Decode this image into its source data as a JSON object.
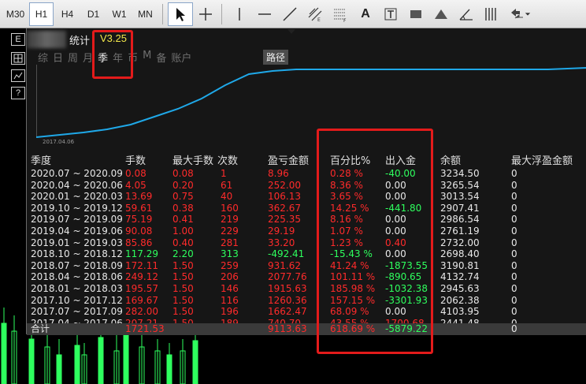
{
  "toolbar": {
    "timeframes": [
      {
        "label": "M30",
        "active": false
      },
      {
        "label": "H1",
        "active": true
      },
      {
        "label": "H4",
        "active": false
      },
      {
        "label": "D1",
        "active": false
      },
      {
        "label": "W1",
        "active": false
      },
      {
        "label": "MN",
        "active": false
      }
    ],
    "text_tool_label": "A"
  },
  "left_buttons": [
    "E",
    "",
    "",
    "?"
  ],
  "panel": {
    "title": "统计",
    "version": "V3.25",
    "tabs": [
      {
        "label": "综",
        "active": false
      },
      {
        "label": "日",
        "active": false
      },
      {
        "label": "周",
        "active": false
      },
      {
        "label": "月",
        "active": false
      },
      {
        "label": "季",
        "active": true
      },
      {
        "label": "年",
        "active": false
      },
      {
        "label": "币",
        "active": false
      },
      {
        "label": "M",
        "active": false
      },
      {
        "label": "备",
        "active": false
      },
      {
        "label": "账户",
        "active": false
      }
    ],
    "route_label": "路径",
    "curve_start_label": "2017.04.06",
    "headers": [
      "季度",
      "手数",
      "最大手数",
      "次数",
      "盈亏金额",
      "百分比%",
      "出入金",
      "余额",
      "最大浮盈金额"
    ],
    "rows": [
      {
        "period": "2020.07 ~ 2020.09",
        "lots": "0.08",
        "max_lots": "0.08",
        "count": "1",
        "pnl": "8.96",
        "pct": "0.28 %",
        "flow": "-40.00",
        "flow_color": "green",
        "balance": "3234.50",
        "max_float": "0"
      },
      {
        "period": "2020.04 ~ 2020.06",
        "lots": "4.05",
        "max_lots": "0.20",
        "count": "61",
        "pnl": "252.00",
        "pct": "8.36 %",
        "flow": "0.00",
        "flow_color": "white",
        "balance": "3265.54",
        "max_float": "0"
      },
      {
        "period": "2020.01 ~ 2020.03",
        "lots": "13.69",
        "max_lots": "0.75",
        "count": "40",
        "pnl": "106.13",
        "pct": "3.65 %",
        "flow": "0.00",
        "flow_color": "white",
        "balance": "3013.54",
        "max_float": "0"
      },
      {
        "period": "2019.10 ~ 2019.12",
        "lots": "59.61",
        "max_lots": "0.38",
        "count": "160",
        "pnl": "362.67",
        "pct": "14.25 %",
        "flow": "-441.80",
        "flow_color": "green",
        "balance": "2907.41",
        "max_float": "0"
      },
      {
        "period": "2019.07 ~ 2019.09",
        "lots": "75.19",
        "max_lots": "0.41",
        "count": "219",
        "pnl": "225.35",
        "pct": "8.16 %",
        "flow": "0.00",
        "flow_color": "white",
        "balance": "2986.54",
        "max_float": "0"
      },
      {
        "period": "2019.04 ~ 2019.06",
        "lots": "90.08",
        "max_lots": "1.00",
        "count": "229",
        "pnl": "29.19",
        "pct": "1.07 %",
        "flow": "0.00",
        "flow_color": "white",
        "balance": "2761.19",
        "max_float": "0"
      },
      {
        "period": "2019.01 ~ 2019.03",
        "lots": "85.86",
        "max_lots": "0.40",
        "count": "281",
        "pnl": "33.20",
        "pct": "1.23 %",
        "flow": "0.40",
        "flow_color": "red",
        "balance": "2732.00",
        "max_float": "0"
      },
      {
        "period": "2018.10 ~ 2018.12",
        "lots": "117.29",
        "max_lots": "2.20",
        "count": "313",
        "pnl": "-492.41",
        "pct": "-15.43 %",
        "flow": "0.00",
        "flow_color": "white",
        "balance": "2698.40",
        "max_float": "0",
        "neg": true
      },
      {
        "period": "2018.07 ~ 2018.09",
        "lots": "172.11",
        "max_lots": "1.50",
        "count": "259",
        "pnl": "931.62",
        "pct": "41.24 %",
        "flow": "-1873.55",
        "flow_color": "green",
        "balance": "3190.81",
        "max_float": "0"
      },
      {
        "period": "2018.04 ~ 2018.06",
        "lots": "249.12",
        "max_lots": "1.50",
        "count": "206",
        "pnl": "2077.76",
        "pct": "101.11 %",
        "flow": "-890.65",
        "flow_color": "green",
        "balance": "4132.74",
        "max_float": "0"
      },
      {
        "period": "2018.01 ~ 2018.03",
        "lots": "195.57",
        "max_lots": "1.50",
        "count": "146",
        "pnl": "1915.63",
        "pct": "185.98 %",
        "flow": "-1032.38",
        "flow_color": "green",
        "balance": "2945.63",
        "max_float": "0"
      },
      {
        "period": "2017.10 ~ 2017.12",
        "lots": "169.67",
        "max_lots": "1.50",
        "count": "116",
        "pnl": "1260.36",
        "pct": "157.15 %",
        "flow": "-3301.93",
        "flow_color": "green",
        "balance": "2062.38",
        "max_float": "0"
      },
      {
        "period": "2017.07 ~ 2017.09",
        "lots": "282.00",
        "max_lots": "1.50",
        "count": "196",
        "pnl": "1662.47",
        "pct": "68.09 %",
        "flow": "0.00",
        "flow_color": "white",
        "balance": "4103.95",
        "max_float": "0"
      },
      {
        "period": "2017.04 ~ 2017.06",
        "lots": "207.21",
        "max_lots": "1.50",
        "count": "189",
        "pnl": "740.70",
        "pct": "43.55 %",
        "flow": "1700.68",
        "flow_color": "red",
        "balance": "2441.48",
        "max_float": "0"
      }
    ],
    "total": {
      "label": "合计",
      "lots": "1721.53",
      "pnl": "9113.63",
      "pct": "618.69 %",
      "flow": "-5879.22",
      "max_float": "0"
    }
  },
  "colors": {
    "positive": "#ff2b2b",
    "negative": "#2eff5e",
    "curve": "#1fa8e8",
    "highlight": "#e31b1b",
    "version": "#f2e84b"
  }
}
